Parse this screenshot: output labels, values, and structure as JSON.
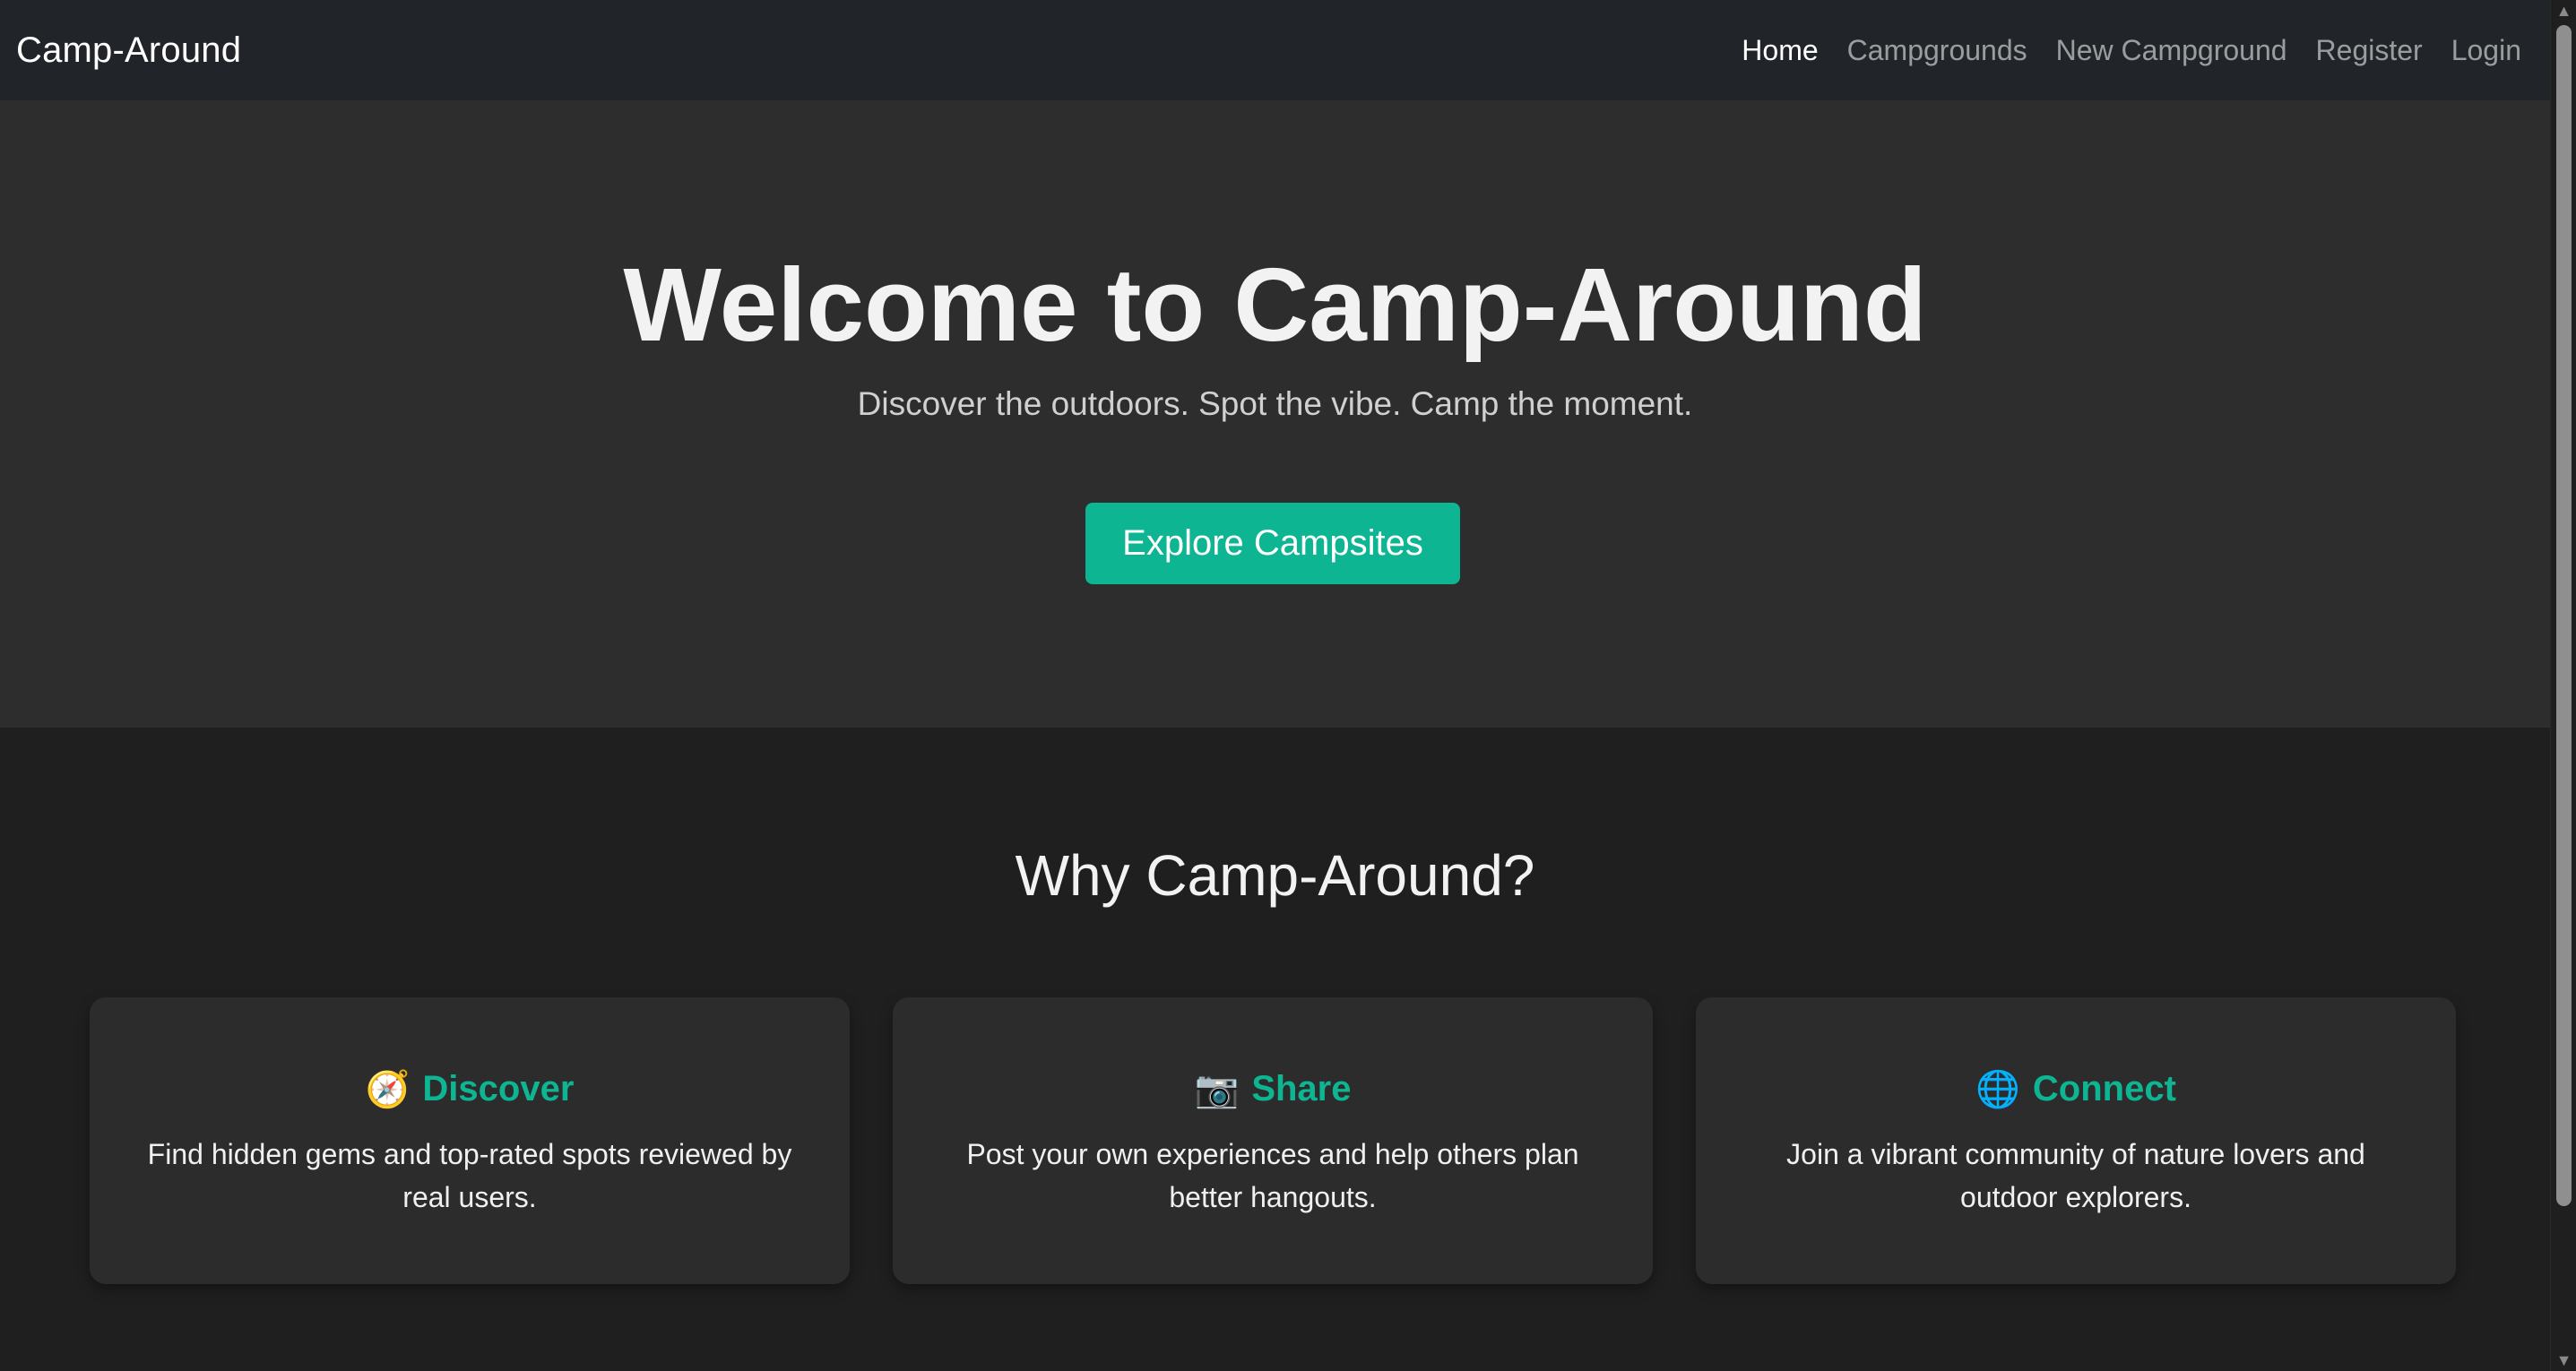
{
  "navbar": {
    "brand": "Camp-Around",
    "links": [
      {
        "label": "Home",
        "active": true
      },
      {
        "label": "Campgrounds",
        "active": false
      },
      {
        "label": "New Campground",
        "active": false
      },
      {
        "label": "Register",
        "active": false
      },
      {
        "label": "Login",
        "active": false
      }
    ]
  },
  "hero": {
    "title": "Welcome to Camp-Around",
    "subtitle": "Discover the outdoors. Spot the vibe. Camp the moment.",
    "button_label": "Explore Campsites"
  },
  "features": {
    "title": "Why Camp-Around?",
    "cards": [
      {
        "icon": "🧭",
        "icon_name": "compass-icon",
        "title": "Discover",
        "text": "Find hidden gems and top-rated spots reviewed by real users."
      },
      {
        "icon": "📷",
        "icon_name": "camera-icon",
        "title": "Share",
        "text": "Post your own experiences and help others plan better hangouts."
      },
      {
        "icon": "🌐",
        "icon_name": "globe-icon",
        "title": "Connect",
        "text": "Join a vibrant community of nature lovers and outdoor explorers."
      }
    ]
  },
  "colors": {
    "accent": "#0db592",
    "navbar_bg": "#212529",
    "hero_bg": "#2d2d2d",
    "page_bg": "#1f1f1f",
    "card_bg": "#2c2c2c"
  }
}
